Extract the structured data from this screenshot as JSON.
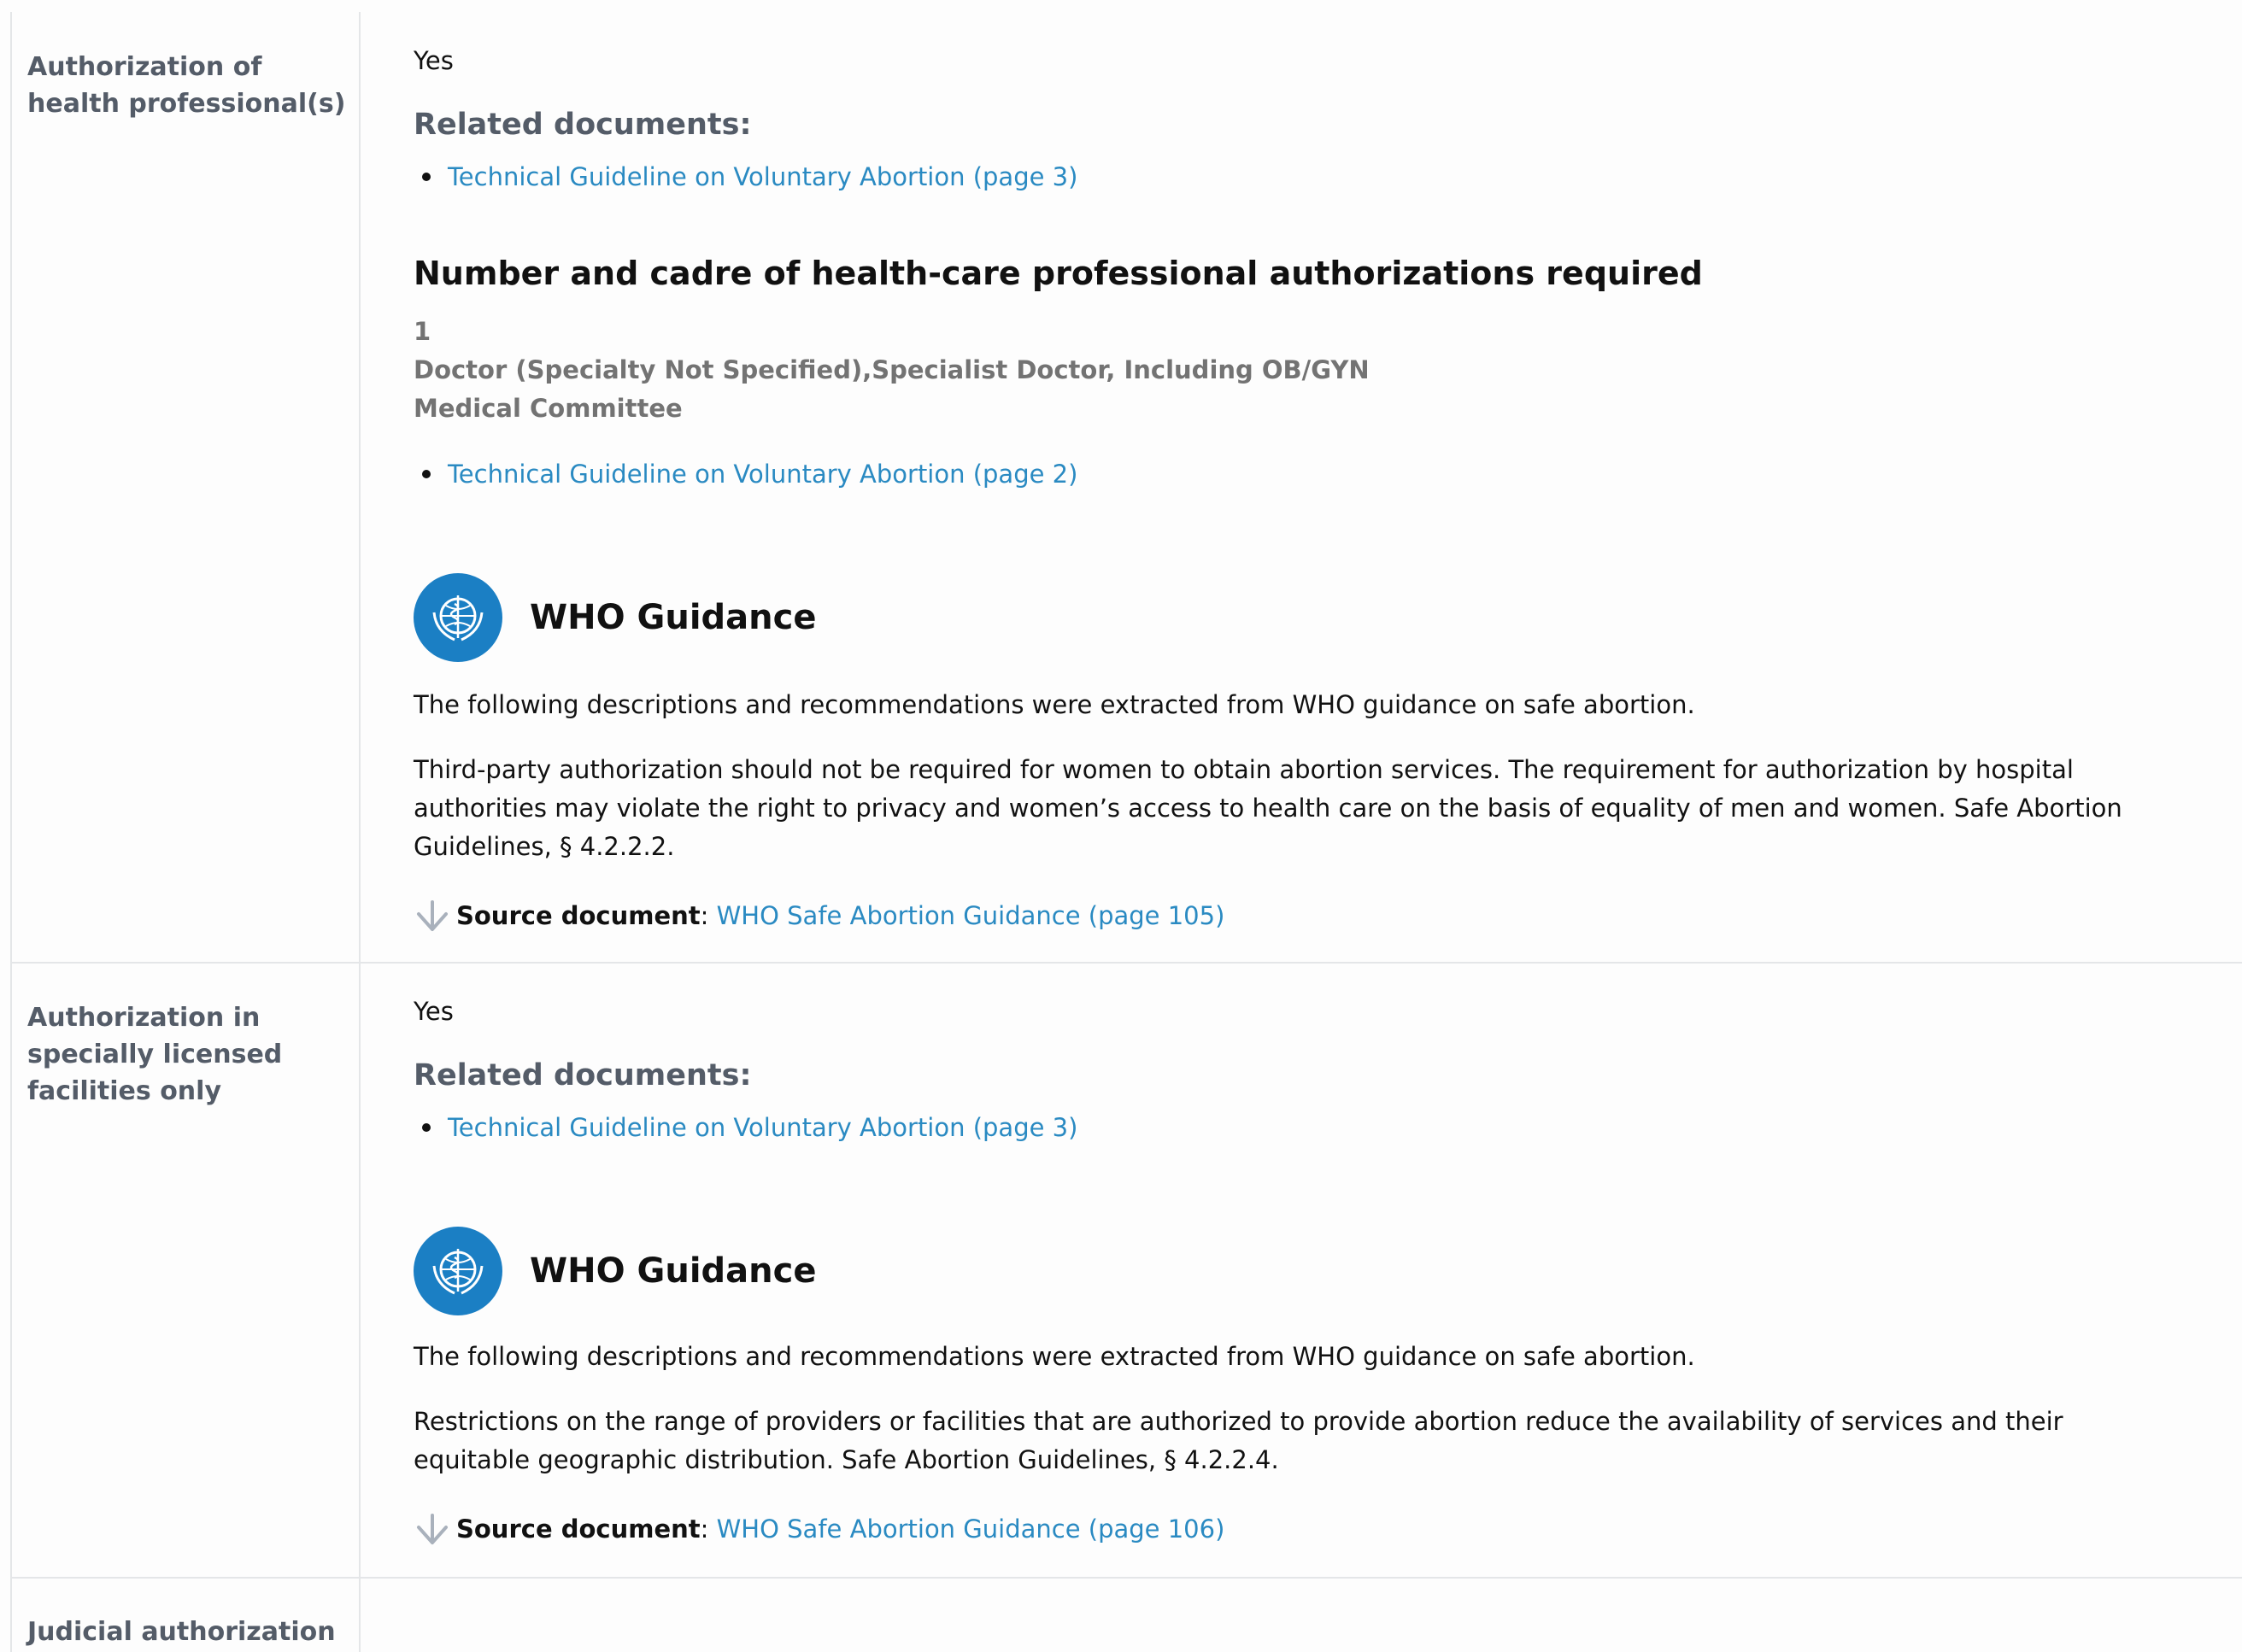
{
  "rows": [
    {
      "label": "Authorization of health professional(s)",
      "answer": "Yes",
      "related_title": "Related documents:",
      "related_links": [
        "Technical Guideline on Voluntary Abortion (page 3)"
      ],
      "subsection": {
        "title": "Number and cadre of health-care professional authorizations required",
        "number": "1",
        "cadre": "Doctor (Specialty Not Specified),Specialist Doctor, Including OB/GYN",
        "committee": "Medical Committee",
        "link": "Technical Guideline on Voluntary Abortion (page 2)"
      },
      "who": {
        "title": "WHO Guidance",
        "intro": "The following descriptions and recommendations were extracted from WHO guidance on safe abortion.",
        "text": "Third-party authorization should not be required for women to obtain abortion services. The requirement for authorization by hospital authorities may violate the right to privacy and women’s access to health care on the basis of equality of men and women. Safe Abortion Guidelines, § 4.2.2.2.",
        "source_label": "Source document",
        "source_link": "WHO Safe Abortion Guidance (page 105)"
      }
    },
    {
      "label": "Authorization in specially licensed facilities only",
      "answer": "Yes",
      "related_title": "Related documents:",
      "related_links": [
        "Technical Guideline on Voluntary Abortion (page 3)"
      ],
      "who": {
        "title": "WHO Guidance",
        "intro": "The following descriptions and recommendations were extracted from WHO guidance on safe abortion.",
        "text": "Restrictions on the range of providers or facilities that are authorized to provide abortion reduce the availability of services and their equitable geographic distribution. Safe Abortion Guidelines, § 4.2.2.4.",
        "source_label": "Source document",
        "source_link": "WHO Safe Abortion Guidance (page 106)"
      }
    },
    {
      "label": "Judicial authorization"
    }
  ],
  "colors": {
    "link": "#2a8ac2",
    "label": "#545c68",
    "who_blue": "#1b7fc4",
    "border": "#e4e6e8"
  }
}
